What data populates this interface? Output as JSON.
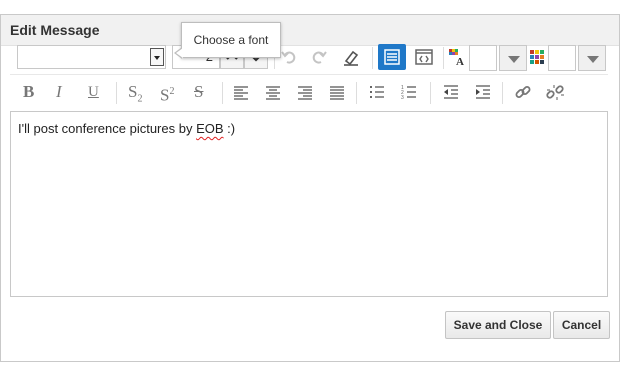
{
  "dialog": {
    "title": "Edit Message"
  },
  "tooltip": {
    "text": "Choose a font"
  },
  "toolbar": {
    "font_value": "",
    "font_size": "2",
    "bold_glyph": "B",
    "italic_glyph": "I",
    "underline_glyph": "U",
    "subscript_glyph": "S",
    "subscript_mark": "2",
    "superscript_glyph": "S",
    "superscript_mark": "2",
    "strike_glyph": "S",
    "icons": [
      "undo-icon",
      "redo-icon",
      "clear-format-icon",
      "rich-text-mode-icon",
      "source-mode-icon",
      "text-color-icon",
      "background-color-icon",
      "align-left-icon",
      "align-center-icon",
      "align-right-icon",
      "justify-icon",
      "bulleted-list-icon",
      "numbered-list-icon",
      "outdent-icon",
      "indent-icon",
      "link-icon",
      "unlink-icon"
    ],
    "active_color": "#1f78c8"
  },
  "editor": {
    "text_before": "I'll post conference pictures by ",
    "text_misspelled": "EOB",
    "text_after": " :)"
  },
  "buttons": {
    "save": "Save and Close",
    "cancel": "Cancel"
  }
}
